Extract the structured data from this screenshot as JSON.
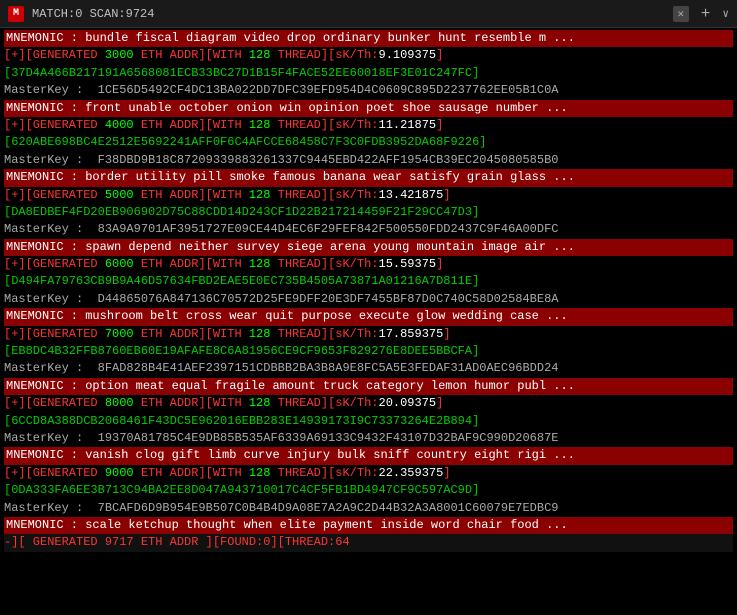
{
  "titlebar": {
    "icon": "M",
    "text": "MATCH:0 SCAN:9724",
    "close_label": "✕",
    "plus_label": "+",
    "chevron_label": "∨"
  },
  "lines": [
    {
      "type": "mnemonic",
      "text": "MNEMONIC : bundle fiscal diagram video drop ordinary bunker hunt resemble m ..."
    },
    {
      "type": "generated",
      "prefix": "[+][GENERATED",
      "val1": "3000",
      "mid1": "ETH ADDR][WITH",
      "val2": "128",
      "mid2": "THREAD][sK/Th:",
      "val3": "9.109375",
      "suffix": "]"
    },
    {
      "type": "addr",
      "text": "37D4A466B217191A6568081ECB33BC27D1B15F4FACE52EE60018EF3E01C247FC"
    },
    {
      "type": "masterkey",
      "text": "MasterKey :  1CE56D5492CF4DC13BA022DD7DFC39EFD954D4C0609C895D2237762EE05B1C0A"
    },
    {
      "type": "mnemonic",
      "text": "MNEMONIC : front unable october onion win opinion poet shoe sausage number ..."
    },
    {
      "type": "generated",
      "prefix": "[+][GENERATED",
      "val1": "4000",
      "mid1": "ETH ADDR][WITH",
      "val2": "128",
      "mid2": "THREAD][sK/Th:",
      "val3": "11.21875",
      "suffix": "]"
    },
    {
      "type": "addr",
      "text": "620ABE698BC4E2512E5692241AFF0F6C4AFCCE68458C7F3C0FDB3952DA68F9226"
    },
    {
      "type": "masterkey",
      "text": "MasterKey :  F38DBD9B18C87209339883261337C9445EBD422AFF1954CB39EC2045080585B0"
    },
    {
      "type": "mnemonic",
      "text": "MNEMONIC : border utility pill smoke famous banana wear satisfy grain glass ..."
    },
    {
      "type": "generated",
      "prefix": "[+][GENERATED",
      "val1": "5000",
      "mid1": "ETH ADDR][WITH",
      "val2": "128",
      "mid2": "THREAD][sK/Th:",
      "val3": "13.421875",
      "suffix": "]"
    },
    {
      "type": "addr",
      "text": "DA8EDBEF4FD20EB906902D75C88CDD14D243CF1D22B217214459F21F29CC47D3"
    },
    {
      "type": "masterkey",
      "text": "MasterKey :  83A9A9701AF3951727E09CE44D4EC6F29FEF842F500550FDD2437C9F46A00DFC"
    },
    {
      "type": "mnemonic",
      "text": "MNEMONIC : spawn depend neither survey siege arena young mountain image air ..."
    },
    {
      "type": "generated",
      "prefix": "[+][GENERATED",
      "val1": "6000",
      "mid1": "ETH ADDR][WITH",
      "val2": "128",
      "mid2": "THREAD][sK/Th:",
      "val3": "15.59375",
      "suffix": "]"
    },
    {
      "type": "addr",
      "text": "D494FA79763CB9B9A46D57634FBD2EAE5E0EC735B4505A73871A01216A7D811E"
    },
    {
      "type": "masterkey",
      "text": "MasterKey :  D44865076A847136C70572D25FE9DFF20E3DF7455BF87D0C740C58D02584BE8A"
    },
    {
      "type": "mnemonic",
      "text": "MNEMONIC : mushroom belt cross wear quit purpose execute glow wedding case ..."
    },
    {
      "type": "generated",
      "prefix": "[+][GENERATED",
      "val1": "7000",
      "mid1": "ETH ADDR][WITH",
      "val2": "128",
      "mid2": "THREAD][sK/Th:",
      "val3": "17.859375",
      "suffix": "]"
    },
    {
      "type": "addr",
      "text": "EB8DC4B32FFB8760EB60E19AFAFE8C6A81956CE9CF9653F829276E8DEE5BBCFA"
    },
    {
      "type": "masterkey",
      "text": "MasterKey :  8FAD828B4E41AEF2397151CDBBB2BA3B8A9E8FC5A5E3FEDAF31AD0AEC96BDD24"
    },
    {
      "type": "mnemonic",
      "text": "MNEMONIC : option meat equal fragile amount truck category lemon humor publ ..."
    },
    {
      "type": "generated",
      "prefix": "[+][GENERATED",
      "val1": "8000",
      "mid1": "ETH ADDR][WITH",
      "val2": "128",
      "mid2": "THREAD][sK/Th:",
      "val3": "20.09375",
      "suffix": "]"
    },
    {
      "type": "addr",
      "text": "6CCD8A388DCB2068461F43DC5E962016EBB283E14939173I9C73373264E2B894"
    },
    {
      "type": "masterkey",
      "text": "MasterKey :  19370A81785C4E9DB85B535AF6339A69133C9432F43107D32BAF9C990D20687E"
    },
    {
      "type": "mnemonic",
      "text": "MNEMONIC : vanish clog gift limb curve injury bulk sniff country eight rigi ..."
    },
    {
      "type": "generated",
      "prefix": "[+][GENERATED",
      "val1": "9000",
      "mid1": "ETH ADDR][WITH",
      "val2": "128",
      "mid2": "THREAD][sK/Th:",
      "val3": "22.359375",
      "suffix": "]"
    },
    {
      "type": "addr",
      "text": "0DA333FA6EE3B713C94BA2EE8D047A943710017C4CF5FB1BD4947CF9C597AC9D"
    },
    {
      "type": "masterkey",
      "text": "MasterKey :  7BCAFD6D9B954E9B507C0B4B4D9A08E7A2A9C2D44B32A3A8001C60079E7EDBC9"
    },
    {
      "type": "mnemonic",
      "text": "MNEMONIC : scale ketchup thought when elite payment inside word chair food ..."
    },
    {
      "type": "status",
      "text": "-][ GENERATED 9717 ETH ADDR ][FOUND:0][THREAD:64"
    }
  ]
}
